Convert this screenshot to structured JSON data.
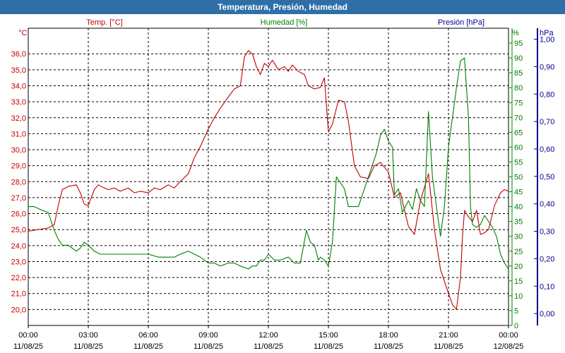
{
  "window": {
    "title": "Temperatura, Presión, Humedad"
  },
  "colors": {
    "temp": "#c00000",
    "hum": "#008000",
    "pres": "#000090",
    "grid": "#000000",
    "titlebar": "#2e6fa8"
  },
  "chart_data": {
    "type": "line",
    "title": "Temperatura, Presión, Humedad",
    "grid": true,
    "x_ticks": [
      {
        "time": "00:00",
        "date": "11/08/25"
      },
      {
        "time": "03:00",
        "date": "11/08/25"
      },
      {
        "time": "06:00",
        "date": "11/08/25"
      },
      {
        "time": "09:00",
        "date": "11/08/25"
      },
      {
        "time": "12:00",
        "date": "11/08/25"
      },
      {
        "time": "15:00",
        "date": "11/08/25"
      },
      {
        "time": "18:00",
        "date": "11/08/25"
      },
      {
        "time": "21:00",
        "date": "11/08/25"
      },
      {
        "time": "00:00",
        "date": "12/08/25"
      }
    ],
    "x_range_hours": [
      0,
      24
    ],
    "axes": {
      "temp": {
        "label": "Temp. [°C]",
        "unit": "°C",
        "min": 19.0,
        "max": 37.6,
        "ticks": [
          "20,0",
          "21,0",
          "22,0",
          "23,0",
          "24,0",
          "25,0",
          "26,0",
          "27,0",
          "28,0",
          "29,0",
          "30,0",
          "31,0",
          "32,0",
          "33,0",
          "34,0",
          "35,0",
          "36,0"
        ],
        "tick_values": [
          20,
          21,
          22,
          23,
          24,
          25,
          26,
          27,
          28,
          29,
          30,
          31,
          32,
          33,
          34,
          35,
          36
        ]
      },
      "hum": {
        "label": "Humedad [%]",
        "unit": "%",
        "min": 0,
        "max": 100,
        "ticks": [
          "0",
          "5",
          "10",
          "15",
          "20",
          "25",
          "30",
          "35",
          "40",
          "45",
          "50",
          "55",
          "60",
          "65",
          "70",
          "75",
          "80",
          "85",
          "90",
          "95"
        ],
        "tick_values": [
          0,
          5,
          10,
          15,
          20,
          25,
          30,
          35,
          40,
          45,
          50,
          55,
          60,
          65,
          70,
          75,
          80,
          85,
          90,
          95
        ]
      },
      "pres": {
        "label": "Presión [hPa]",
        "unit": "hPa",
        "min": -0.0434,
        "max": 1.04,
        "ticks": [
          "0,00",
          "0,10",
          "0,20",
          "0,30",
          "0,40",
          "0,50",
          "0,60",
          "0,70",
          "0,80",
          "0,90",
          "1,00"
        ],
        "tick_values": [
          0,
          0.1,
          0.2,
          0.3,
          0.4,
          0.5,
          0.6,
          0.7,
          0.8,
          0.9,
          1.0
        ]
      }
    },
    "series": [
      {
        "name": "Temp. [°C]",
        "axis": "temp",
        "color": "#c00000",
        "x": [
          0,
          0.5,
          1.0,
          1.3,
          1.5,
          1.7,
          2.0,
          2.4,
          2.6,
          2.8,
          3.0,
          3.3,
          3.5,
          3.8,
          4.0,
          4.3,
          4.6,
          5.0,
          5.3,
          5.6,
          6.0,
          6.3,
          6.6,
          7.0,
          7.3,
          7.6,
          8.0,
          8.3,
          8.6,
          9.0,
          9.3,
          9.6,
          10.0,
          10.3,
          10.6,
          10.8,
          11.0,
          11.2,
          11.4,
          11.6,
          11.8,
          12.0,
          12.2,
          12.5,
          12.8,
          13.0,
          13.2,
          13.5,
          13.8,
          14.0,
          14.3,
          14.6,
          14.8,
          15.0,
          15.2,
          15.5,
          15.8,
          16.0,
          16.3,
          16.6,
          17.0,
          17.3,
          17.6,
          18.0,
          18.3,
          18.6,
          19.0,
          19.3,
          19.6,
          20.0,
          20.3,
          20.6,
          21.0,
          21.2,
          21.4,
          21.6,
          21.7,
          21.8,
          22.0,
          22.2,
          22.4,
          22.6,
          22.8,
          23.0,
          23.3,
          23.6,
          23.8,
          24.0
        ],
        "y": [
          24.9,
          25.0,
          25.1,
          25.3,
          26.5,
          27.5,
          27.7,
          27.8,
          27.3,
          26.6,
          26.5,
          27.5,
          27.8,
          27.6,
          27.5,
          27.6,
          27.4,
          27.6,
          27.3,
          27.4,
          27.3,
          27.6,
          27.5,
          27.8,
          27.6,
          28.0,
          28.5,
          29.5,
          30.2,
          31.3,
          32.0,
          32.6,
          33.3,
          33.8,
          34.0,
          35.8,
          36.2,
          36.0,
          35.2,
          34.7,
          35.4,
          35.2,
          35.6,
          35.0,
          35.2,
          34.9,
          35.3,
          34.9,
          34.7,
          34.0,
          33.8,
          33.9,
          34.5,
          31.1,
          31.6,
          33.1,
          33.0,
          31.8,
          29.0,
          28.3,
          28.2,
          29.0,
          29.2,
          28.6,
          27.0,
          27.3,
          25.2,
          24.7,
          26.8,
          28.5,
          25.0,
          22.5,
          21.0,
          20.3,
          20.0,
          22.0,
          24.5,
          26.2,
          25.8,
          25.5,
          26.2,
          24.7,
          24.8,
          25.0,
          26.5,
          27.3,
          27.5,
          27.4
        ]
      },
      {
        "name": "Humedad [%]",
        "axis": "hum",
        "color": "#008000",
        "x": [
          0,
          0.3,
          0.6,
          1.0,
          1.3,
          1.5,
          1.7,
          2.0,
          2.2,
          2.4,
          2.6,
          2.8,
          3.0,
          3.3,
          3.6,
          4.0,
          4.3,
          4.6,
          5.0,
          5.5,
          6.0,
          6.5,
          7.0,
          7.3,
          7.6,
          8.0,
          8.3,
          8.6,
          9.0,
          9.3,
          9.6,
          10.0,
          10.3,
          10.6,
          11.0,
          11.2,
          11.4,
          11.6,
          11.8,
          12.0,
          12.3,
          12.6,
          13.0,
          13.3,
          13.6,
          13.9,
          14.1,
          14.3,
          14.5,
          14.6,
          14.8,
          15.0,
          15.2,
          15.4,
          15.6,
          15.8,
          16.0,
          16.2,
          16.5,
          16.8,
          17.0,
          17.2,
          17.4,
          17.6,
          17.8,
          18.0,
          18.2,
          18.3,
          18.5,
          18.7,
          19.0,
          19.2,
          19.4,
          19.6,
          19.8,
          20.0,
          20.2,
          20.4,
          20.6,
          20.8,
          21.0,
          21.2,
          21.4,
          21.6,
          21.8,
          22.0,
          22.1,
          22.2,
          22.4,
          22.6,
          22.8,
          23.0,
          23.2,
          23.4,
          23.6,
          23.8,
          24.0
        ],
        "y": [
          40,
          40,
          39,
          38,
          32,
          29,
          27,
          27,
          26,
          25,
          26,
          28,
          27,
          25,
          24,
          24,
          24,
          24,
          24,
          24,
          24,
          23,
          23,
          23,
          24,
          25,
          24,
          23,
          21,
          21,
          20,
          21,
          21,
          20,
          19,
          20,
          20,
          22,
          22,
          24,
          22,
          22,
          23,
          21,
          21,
          32,
          28,
          27,
          22,
          23,
          22,
          20,
          28,
          50,
          48,
          46,
          40,
          40,
          40,
          46,
          50,
          54,
          58,
          64,
          66,
          62,
          60,
          44,
          46,
          38,
          42,
          39,
          46,
          42,
          40,
          72,
          50,
          40,
          30,
          40,
          60,
          70,
          80,
          89,
          90,
          70,
          40,
          34,
          33,
          34,
          37,
          35,
          33,
          30,
          24,
          21,
          19
        ]
      },
      {
        "name": "Presión [hPa]",
        "axis": "pres",
        "color": "#000090",
        "x": [],
        "y": []
      }
    ]
  }
}
